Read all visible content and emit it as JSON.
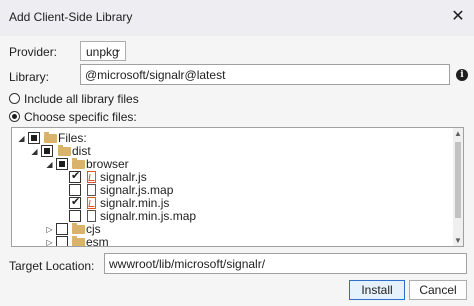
{
  "dialog": {
    "title": "Add Client-Side Library",
    "close_glyph": "✕"
  },
  "provider": {
    "label": "Provider:",
    "value": "unpkg"
  },
  "library": {
    "label": "Library:",
    "value": "@microsoft/signalr@latest"
  },
  "options": {
    "include_all": "Include all library files",
    "choose_specific": "Choose specific files:",
    "selected": "choose_specific"
  },
  "tree": {
    "items": [
      {
        "label": "Files:",
        "depth": 0,
        "expanded": true,
        "check": "indeterminate",
        "icon": "folder-icon"
      },
      {
        "label": "dist",
        "depth": 1,
        "expanded": true,
        "check": "indeterminate",
        "icon": "folder-icon"
      },
      {
        "label": "browser",
        "depth": 2,
        "expanded": true,
        "check": "indeterminate",
        "icon": "folder-icon"
      },
      {
        "label": "signalr.js",
        "depth": 3,
        "check": "checked",
        "icon": "js-file-icon"
      },
      {
        "label": "signalr.js.map",
        "depth": 3,
        "check": "unchecked",
        "icon": "file-icon"
      },
      {
        "label": "signalr.min.js",
        "depth": 3,
        "check": "checked",
        "icon": "js-file-icon"
      },
      {
        "label": "signalr.min.js.map",
        "depth": 3,
        "check": "unchecked",
        "icon": "file-icon"
      },
      {
        "label": "cjs",
        "depth": 2,
        "expanded": false,
        "check": "unchecked",
        "icon": "folder-icon"
      },
      {
        "label": "esm",
        "depth": 2,
        "expanded": false,
        "check": "unchecked",
        "icon": "folder-icon"
      }
    ]
  },
  "target": {
    "label": "Target Location:",
    "value": "wwwroot/lib/microsoft/signalr/"
  },
  "buttons": {
    "install": "Install",
    "cancel": "Cancel"
  }
}
